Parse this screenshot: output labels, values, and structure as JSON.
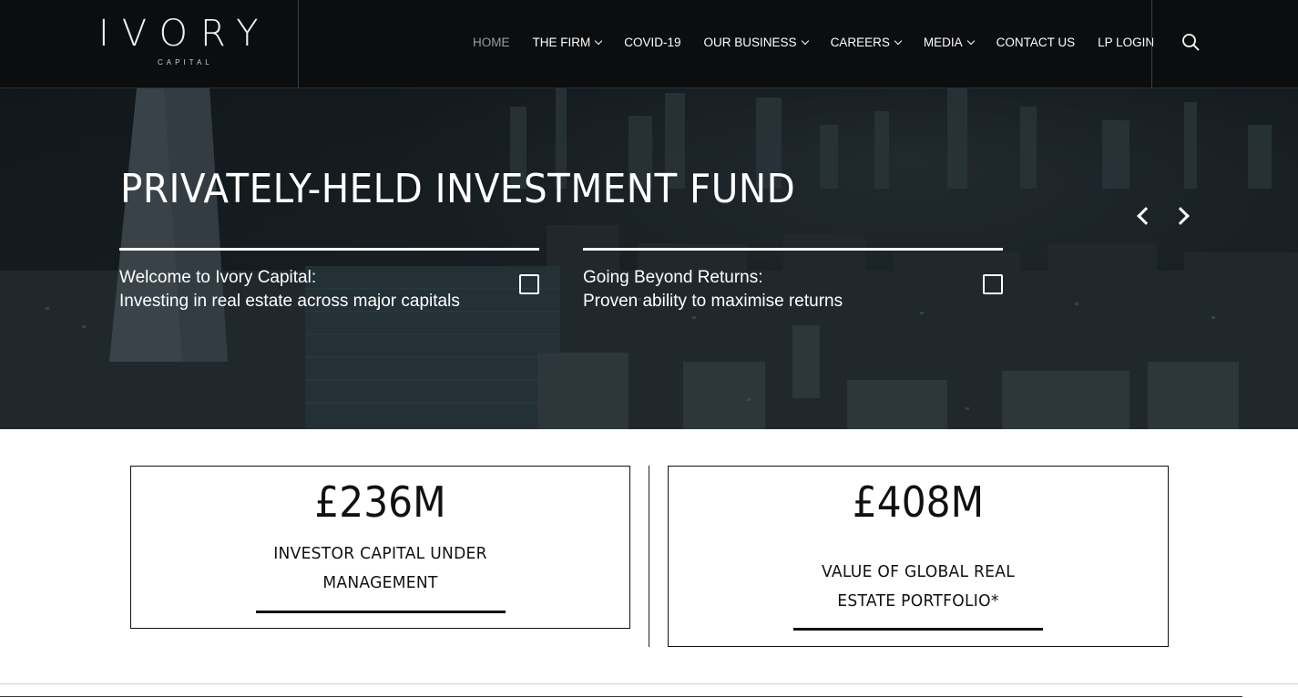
{
  "brand": {
    "name": "IVORY",
    "sub": "CAPITAL"
  },
  "nav": {
    "items": [
      {
        "label": "HOME",
        "dropdown": false,
        "active": true
      },
      {
        "label": "THE FIRM",
        "dropdown": true,
        "active": false
      },
      {
        "label": "COVID-19",
        "dropdown": false,
        "active": false
      },
      {
        "label": "OUR BUSINESS",
        "dropdown": true,
        "active": false
      },
      {
        "label": "CAREERS",
        "dropdown": true,
        "active": false
      },
      {
        "label": "MEDIA",
        "dropdown": true,
        "active": false
      },
      {
        "label": "CONTACT US",
        "dropdown": false,
        "active": false
      },
      {
        "label": "LP LOGIN",
        "dropdown": false,
        "active": false
      }
    ],
    "search_icon": "search-icon"
  },
  "hero": {
    "title": "PRIVATELY-HELD INVESTMENT FUND",
    "slides": [
      {
        "line1": "Welcome to Ivory Capital:",
        "line2": "Investing in real estate across major capitals"
      },
      {
        "line1": "Going Beyond Returns:",
        "line2": "Proven ability to maximise returns"
      }
    ]
  },
  "stats": [
    {
      "value": "£236M",
      "label_line1": "INVESTOR CAPITAL UNDER",
      "label_line2": "MANAGEMENT"
    },
    {
      "value": "£408M",
      "label_line1": "VALUE OF GLOBAL REAL",
      "label_line2": "ESTATE PORTFOLIO*"
    }
  ],
  "colors": {
    "header_bg": "#0b0d0f",
    "nav_active": "#9c9c9c",
    "text_dark": "#111111"
  }
}
